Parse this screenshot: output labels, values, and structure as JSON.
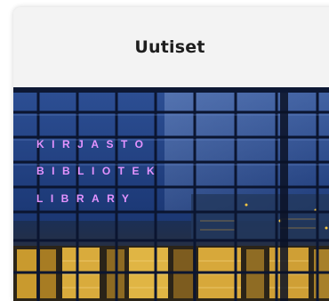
{
  "news_card": {
    "title": "Uutiset",
    "image": {
      "sign_lines": [
        "KIRJASTO",
        "BIBLIOTEK",
        "LIBRARY"
      ],
      "sign_color": "#d77bff",
      "sky_color": "#1c3f8c",
      "light_color": "#f4c542"
    }
  }
}
